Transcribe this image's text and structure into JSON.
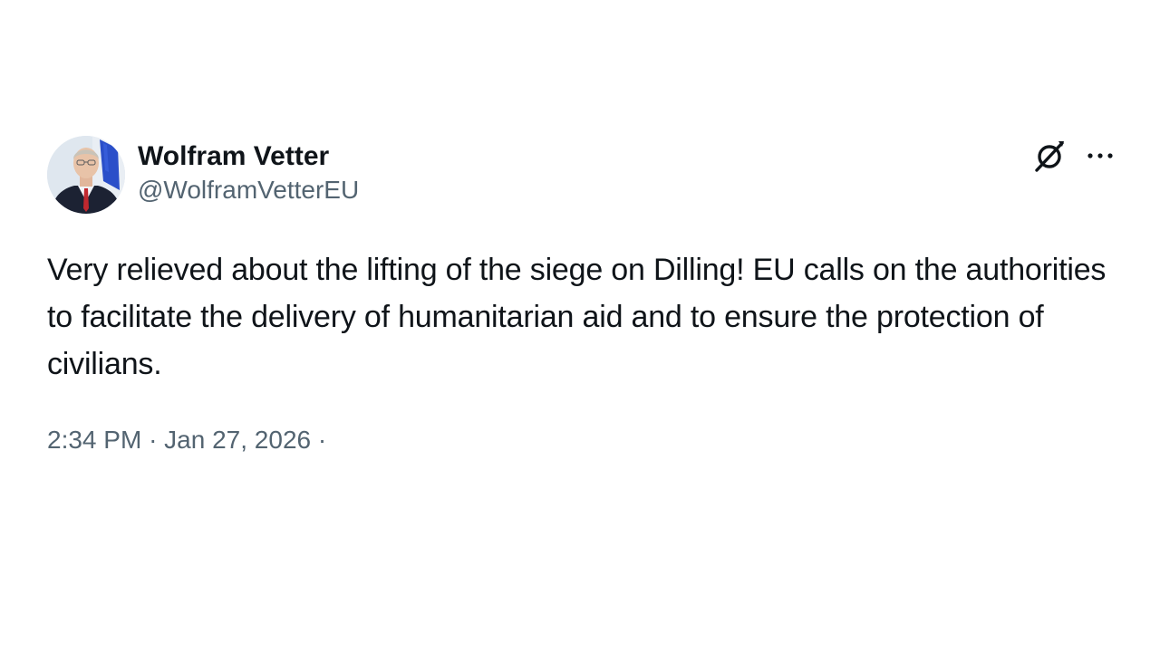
{
  "author": {
    "display_name": "Wolfram Vetter",
    "handle": "@WolframVetterEU"
  },
  "icons": {
    "avatar": "profile-photo",
    "grok": "grok-icon",
    "more": "more-options-icon"
  },
  "tweet": {
    "text": "Very relieved about the lifting of the siege on Dilling! EU calls on the authorities to facilitate the delivery of humanitarian aid and to ensure the protection of civilians.",
    "time": "2:34 PM",
    "separator": "·",
    "date": "Jan 27, 2026",
    "trailing_separator": "·"
  },
  "colors": {
    "text_primary": "#0f1419",
    "text_secondary": "#536471"
  }
}
